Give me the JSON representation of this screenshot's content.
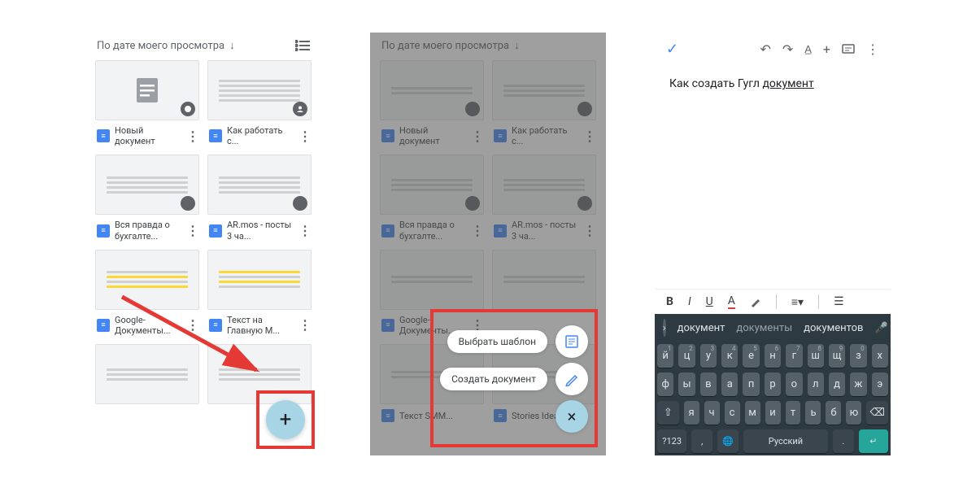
{
  "panel1": {
    "sort_label": "По дате моего просмотра",
    "docs": [
      {
        "title": "Новый документ",
        "hl": false,
        "blank": true
      },
      {
        "title": "Как работать с...",
        "hl": false
      },
      {
        "title": "Вся правда о бухгалте...",
        "hl": false
      },
      {
        "title": "AR.mos - посты 3 ча...",
        "hl": false
      },
      {
        "title": "Google-Документы...",
        "hl": true
      },
      {
        "title": "Текст на Главную М...",
        "hl": true
      },
      {
        "title": "",
        "hl": false
      },
      {
        "title": "",
        "hl": false
      }
    ]
  },
  "panel2": {
    "sort_label": "По дате моего просмотра",
    "docs": [
      {
        "title": "Новый документ"
      },
      {
        "title": "Как работать с..."
      },
      {
        "title": "Вся правда о бухгалте..."
      },
      {
        "title": "AR.mos - посты 3 ча..."
      },
      {
        "title": "Google-Документы..."
      },
      {
        "title": ""
      },
      {
        "title": "Текст SMM..."
      },
      {
        "title": "Stories Idea_Test"
      }
    ],
    "choose_template": "Выбрать шаблон",
    "create_document": "Создать документ"
  },
  "panel3": {
    "content_prefix": "Как создать Гугл ",
    "content_underlined": "документ",
    "format": {
      "b": "B",
      "i": "I",
      "u": "U",
      "a": "A"
    },
    "suggestions": {
      "s1": "документ",
      "s2": "документы",
      "s3": "документов"
    },
    "keyboard": {
      "r1": [
        "й",
        "ц",
        "у",
        "к",
        "е",
        "н",
        "г",
        "ш",
        "щ",
        "з",
        "х"
      ],
      "r1sup": [
        "1",
        "2",
        "3",
        "4",
        "5",
        "6",
        "7",
        "8",
        "9",
        "0",
        ""
      ],
      "r2": [
        "ф",
        "ы",
        "в",
        "а",
        "п",
        "р",
        "о",
        "л",
        "д",
        "ж",
        "э"
      ],
      "r3": [
        "я",
        "ч",
        "с",
        "м",
        "и",
        "т",
        "ь",
        "б",
        "ю"
      ],
      "bottom": {
        "num": "?123",
        "comma": ",",
        "lang": "Русский",
        "dot": ".",
        "enter": "↵"
      }
    }
  }
}
